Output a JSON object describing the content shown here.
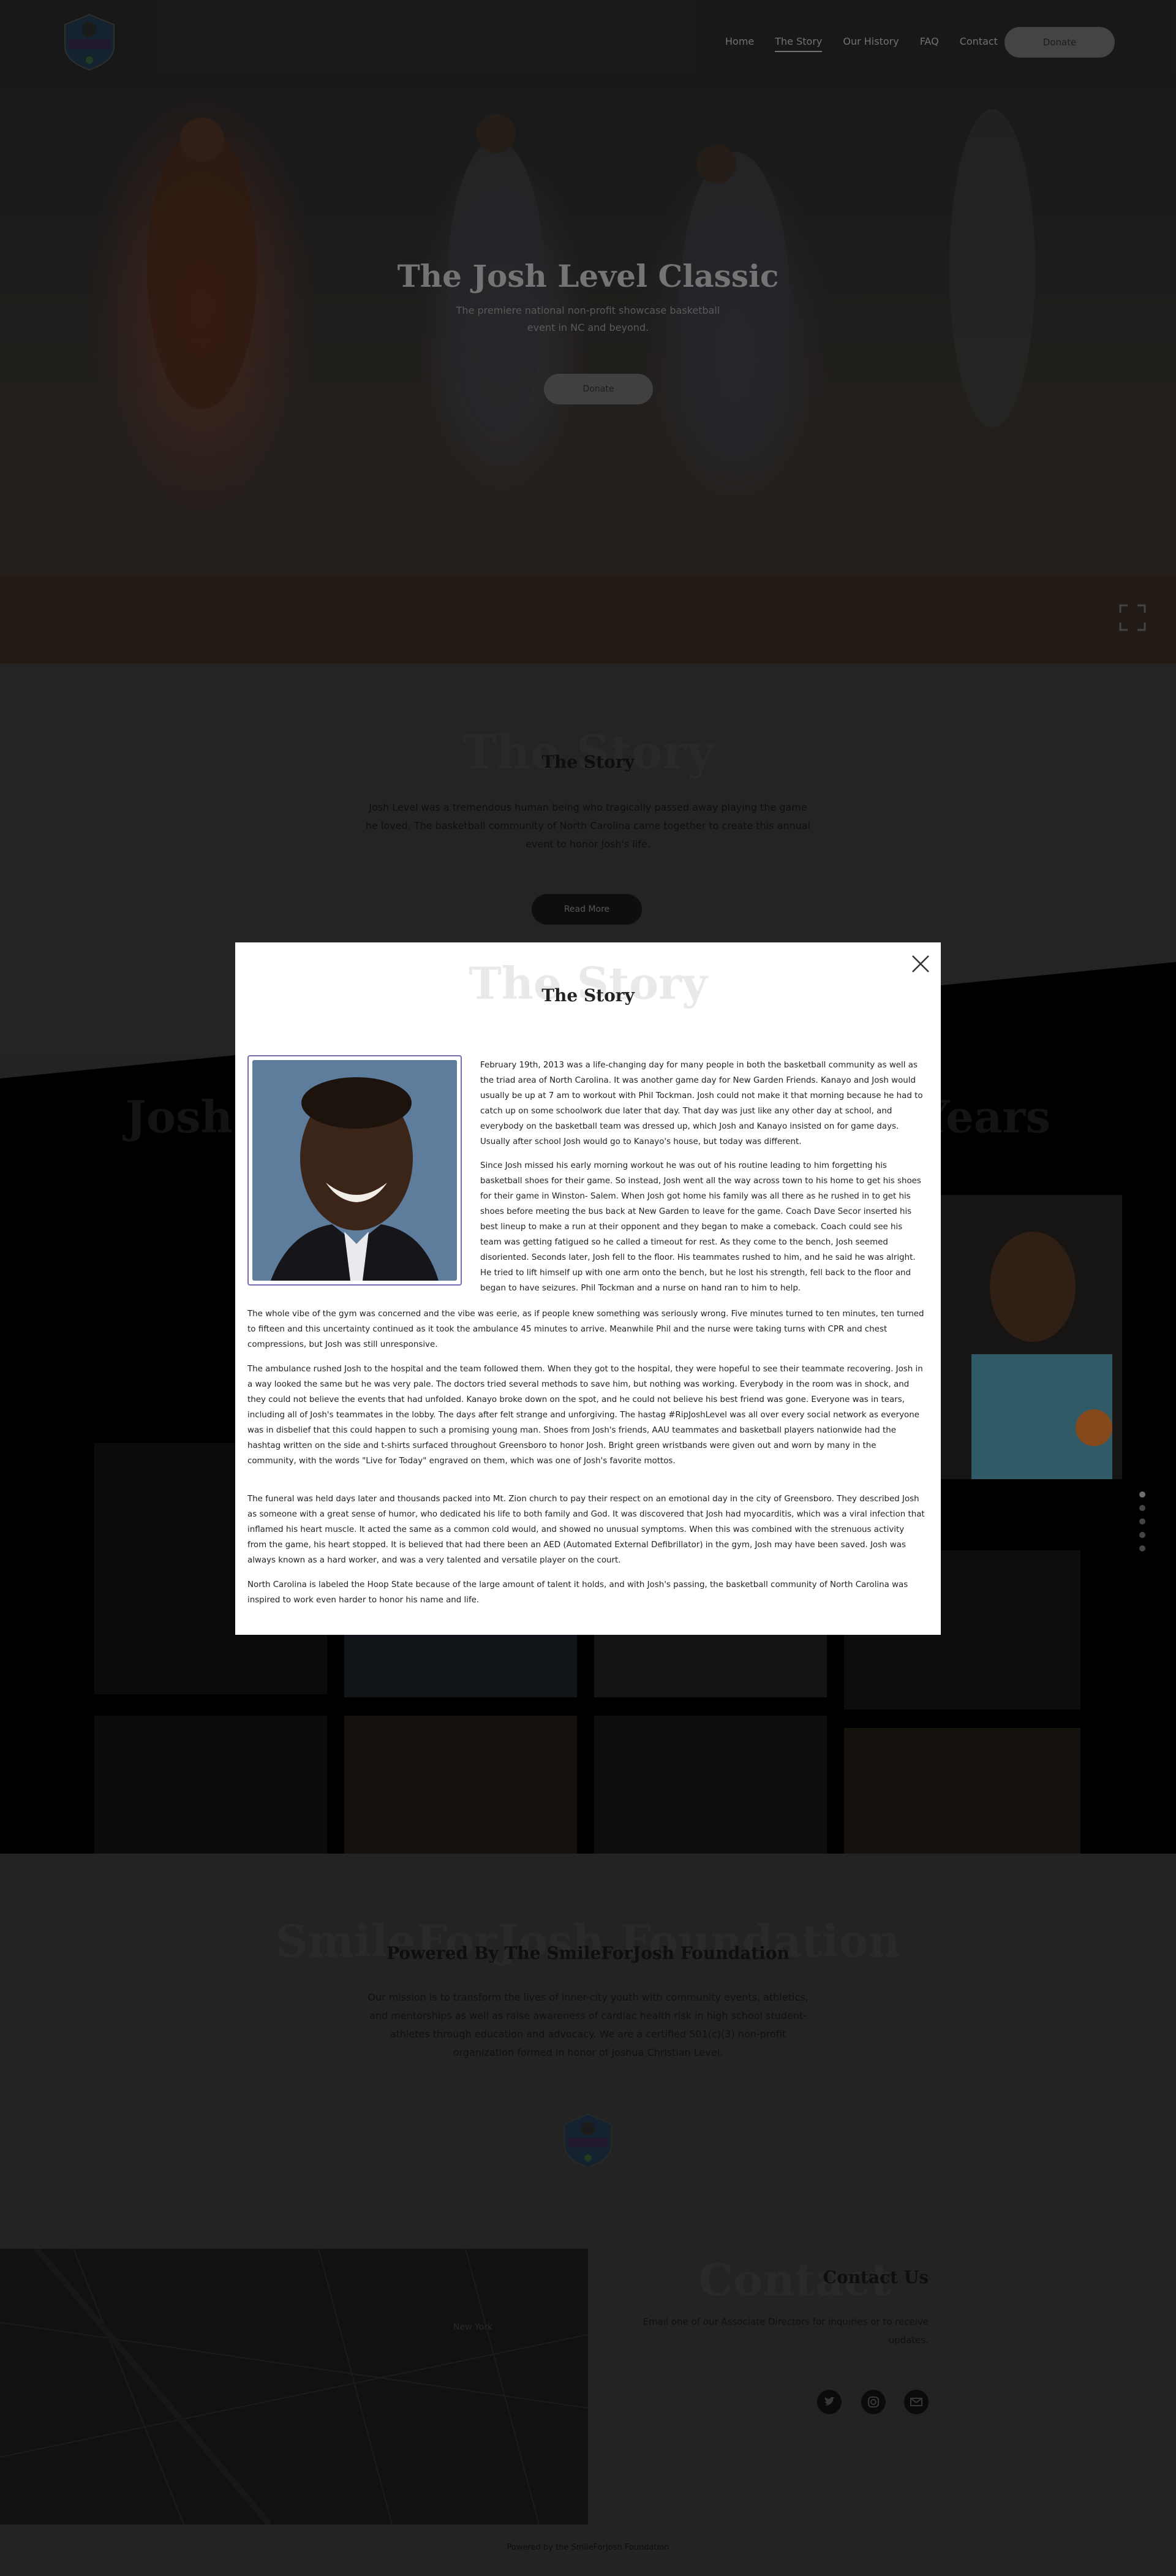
{
  "nav": {
    "links": [
      "Home",
      "The Story",
      "Our History",
      "FAQ",
      "Contact"
    ],
    "active_index": 1,
    "donate_label": "Donate"
  },
  "hero": {
    "title": "The Josh Level Classic",
    "subtitle": "The premiere national non-profit showcase basketball event in NC and beyond.",
    "donate_label": "Donate"
  },
  "story": {
    "ghost": "The Story",
    "title": "The Story",
    "text": "Josh Level was a tremendous human being who tragically passed away playing the game he loved.  The basketball community of North Carolina came together to create this annual event to honor Josh's life.",
    "read_more": "Read More"
  },
  "gallery": {
    "ghost": "Josh Level Classic Through The Years",
    "dots_count": 5,
    "active_dot": 0
  },
  "modal": {
    "ghost": "The Story",
    "title": "The Story",
    "paragraphs": [
      "February 19th, 2013 was a life-changing day for many people in both the basketball community as well as the triad area of North Carolina. It was another game day for New Garden Friends. Kanayo and Josh would usually be up at 7 am to workout with Phil Tockman. Josh could not make it that morning because he had to catch up on some schoolwork due later that day. That day was just like any other day at school, and everybody on the basketball team was dressed up, which Josh and Kanayo insisted on for game days. Usually after school Josh would go to Kanayo's house, but today was different.",
      "Since Josh missed his early morning workout he was out of his routine leading to him forgetting his basketball shoes for their game. So instead, Josh went all the way across town to his home to get his shoes for their game in Winston- Salem. When Josh got home his family was all there as he rushed in to get his shoes before meeting the bus back at New Garden to leave for the game. Coach Dave Secor inserted his best lineup to make a run at their opponent and they began to make a comeback. Coach could see his team was getting fatigued so he called a timeout for rest. As they come to the bench, Josh seemed disoriented. Seconds later, Josh fell to the floor. His teammates rushed to him, and he said he was alright. He tried to lift himself up with one arm onto the bench, but he lost his strength, fell back to the floor and began to have seizures. Phil Tockman and a nurse on hand ran to him to help.",
      "The whole vibe of the gym was concerned and the vibe was eerie, as if people knew something was seriously wrong. Five minutes turned to ten minutes, ten turned to fifteen and this uncertainty continued as it took the ambulance 45 minutes to arrive. Meanwhile Phil and the nurse were taking turns with CPR and chest compressions, but Josh was still unresponsive.",
      "The ambulance rushed Josh to the hospital and the team followed them. When they got to the hospital, they were hopeful to see their teammate recovering. Josh in a way looked the same but he was very pale. The doctors tried several methods to save him, but nothing was working. Everybody in the room was in shock, and they could not believe the events that had unfolded. Kanayo broke down on the spot, and he could not believe his best friend was gone. Everyone was in tears, including all of Josh's teammates in the lobby. The days after felt strange and unforgiving. The hastag #RipJoshLevel was all over every social network as everyone was in disbelief that this could happen to such a promising young man. Shoes from Josh's friends, AAU teammates and basketball players nationwide had the hashtag written on the side and t-shirts surfaced throughout Greensboro to honor Josh. Bright green wristbands were given out and worn by many in the community, with the words \"Live for Today\" engraved on them, which was one of Josh's favorite mottos.",
      "The funeral was held days later and thousands packed into Mt. Zion church to pay their respect on an emotional day in the city of Greensboro. They described Josh as someone with a great sense of humor, who dedicated his life to both family and God. It was discovered that Josh had myocarditis, which was a viral infection that inflamed his heart muscle. It acted the same as a common cold would, and showed no unusual symptoms. When this was combined with the strenuous activity from the game, his heart stopped. It is believed that had there been an AED (Automated External Defibrillator) in the gym, Josh may have been saved. Josh was always known as a hard worker, and was a very talented and versatile player on the court.",
      "North Carolina is labeled the Hoop State because of the large amount of talent it holds, and with Josh's passing, the basketball community of North Carolina was inspired to work even harder to honor his name and life."
    ]
  },
  "foundation": {
    "ghost": "SmileForJosh Foundation",
    "title": "Powered By The SmileForJosh Foundation",
    "text": "Our mission is to transform the lives of inner-city youth with community events, athletics, and mentorships as well as raise awareness of cardiac health risk in high school student-athletes through education and advocacy. We are a certified 501(c)(3) non-profit organization formed in honor of Joshua Christian Level."
  },
  "contact": {
    "ghost": "Contact",
    "title": "Contact Us",
    "text": "Email one of our Associate Directors for inquiries or to receive updates.",
    "map_label": "New York",
    "socials": [
      "twitter-icon",
      "instagram-icon",
      "email-icon"
    ]
  },
  "footer": {
    "text": "Powered by the SmileForJosh Foundation"
  },
  "colors": {
    "modal_bg": "#ffffff",
    "accent_border": "#7a6ab3",
    "page_dark": "#2b2b2b",
    "gallery_bg": "#000000"
  }
}
